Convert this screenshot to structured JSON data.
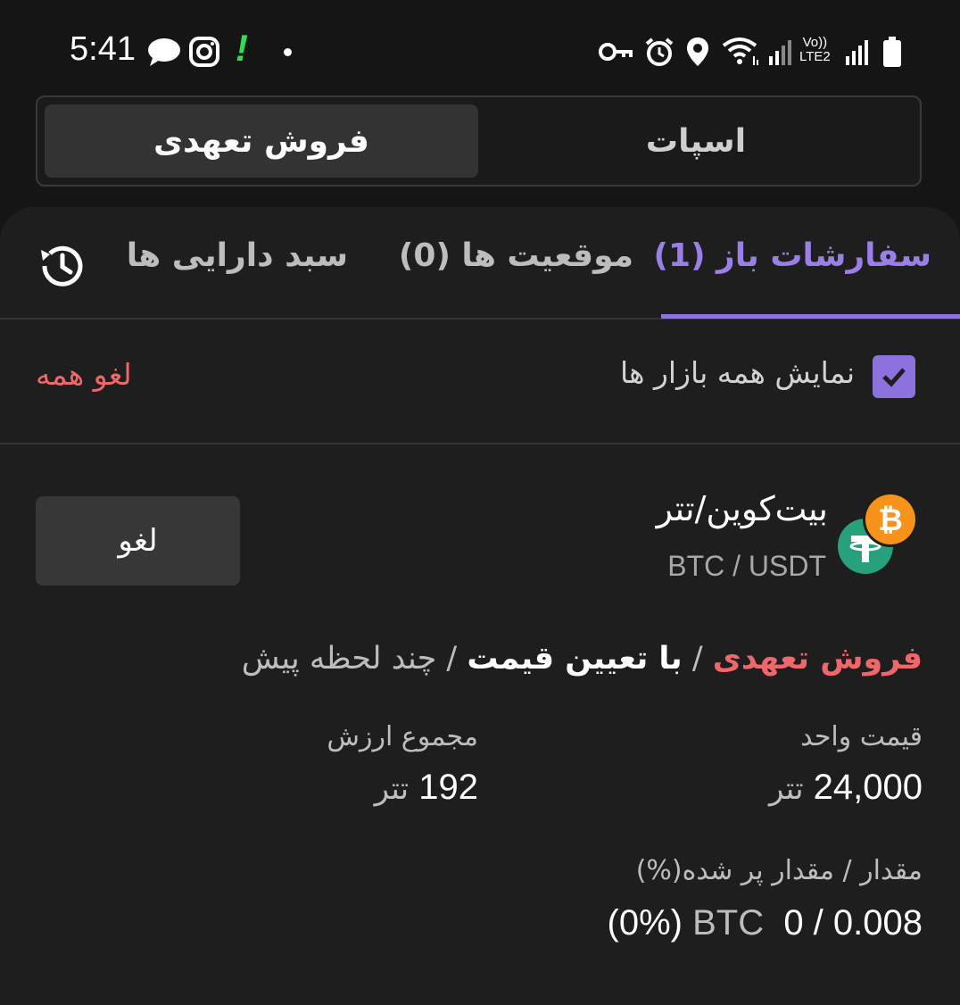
{
  "status_bar": {
    "time": "5:41",
    "icons": [
      "message-icon",
      "instagram-icon",
      "alert-icon",
      "dot",
      "vpn-key-icon",
      "alarm-icon",
      "location-icon",
      "wifi-icon",
      "signal-icon",
      "lte-icon",
      "signal-icon",
      "battery-icon"
    ],
    "lte_top": "Vo))",
    "lte_bottom": "LTE2",
    "alert": "!"
  },
  "market_switch": {
    "active": "فروش تعهدی",
    "inactive": "اسپات"
  },
  "tabs": {
    "open_orders": "سفارشات باز (1)",
    "positions": "موقعیت ها (0)",
    "assets": "سبد دارایی ها"
  },
  "filter": {
    "show_all_markets": "نمایش همه بازار ها",
    "checked": true,
    "cancel_all": "لغو همه"
  },
  "order": {
    "pair_name": "بیت‌کوین/تتر",
    "pair_symbol": "BTC / USDT",
    "cancel_label": "لغو",
    "type": "فروش تعهدی",
    "separator": "/",
    "kind": "با تعیین قیمت",
    "time": "چند لحظه پیش",
    "unit_price_label": "قیمت واحد",
    "unit_price_value": "24,000",
    "unit_price_unit": "تتر",
    "total_label": "مجموع ارزش",
    "total_value": "192",
    "total_unit": "تتر",
    "amount_label": "مقدار / مقدار پر شده(%)",
    "amount_value": "0 / 0.008",
    "amount_unit": "BTC",
    "amount_percent": "(0%)"
  },
  "colors": {
    "accent": "#8d72de",
    "sell": "#f0676b",
    "bitcoin": "#f7931a",
    "tether": "#26a17b"
  }
}
